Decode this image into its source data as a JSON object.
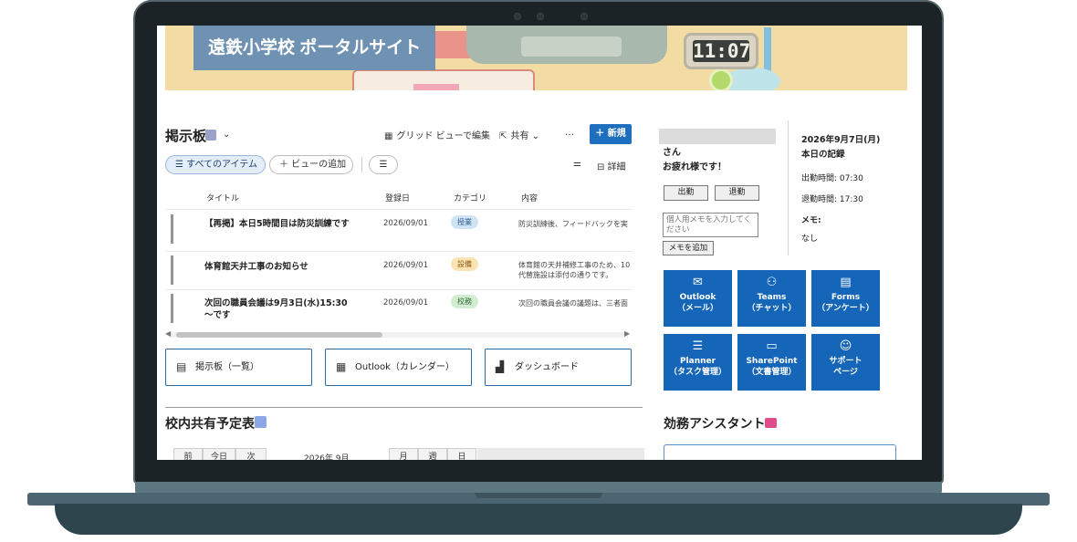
{
  "banner": {
    "title": "遠鉄小学校 ポータルサイト",
    "clock": "11:07"
  },
  "list": {
    "title": "掲示板",
    "commands": {
      "grid_edit": "グリッド ビューで編集",
      "share": "共有",
      "more": "…",
      "new": "新規"
    },
    "views": {
      "all_items": "すべてのアイテム",
      "add_view": "ビューの追加",
      "details": "詳細"
    },
    "columns": [
      "タイトル",
      "登録日",
      "カテゴリ",
      "内容"
    ],
    "rows": [
      {
        "title": "【再掲】本日5時間目は防災訓練です",
        "date": "2026/09/01",
        "category": "授業",
        "body": "防災訓練後、フィードバックを実"
      },
      {
        "title": "体育館天井工事のお知らせ",
        "date": "2026/09/01",
        "category": "設備",
        "body": "体育館の天井補修工事のため、10",
        "body2": "代替施設は添付の通りです。"
      },
      {
        "title": "次回の職員会議は9月3日(水)15:30～です",
        "date": "2026/09/01",
        "category": "校務",
        "body": "次回の職員会議の議題は、三者面"
      }
    ],
    "tag_colors": {
      "授業": "#cfe3f5",
      "設備": "#fbe3b4",
      "校務": "#d2ecd2"
    }
  },
  "links": [
    {
      "label": "掲示板（一覧）",
      "icon": "message-icon"
    },
    {
      "label": "Outlook（カレンダー）",
      "icon": "calendar-icon"
    },
    {
      "label": "ダッシュボード",
      "icon": "chart-icon"
    }
  ],
  "schedule": {
    "title": "校内共有予定表",
    "prev": "前",
    "today": "今日",
    "next": "次",
    "month": "2026年 9月",
    "month_view": "月",
    "week_view": "週",
    "day_view": "日"
  },
  "user": {
    "honorific": "さん",
    "greeting": "お疲れ様です！",
    "clock_in": "出勤",
    "clock_out": "退勤",
    "memo_placeholder": "個人用メモを入力してください",
    "memo_add": "メモを追加"
  },
  "record": {
    "date": "2026年9月7日(月)",
    "heading": "本日の記録",
    "clock_in_time": "出勤時間: 07:30",
    "clock_out_time": "退勤時間: 17:30",
    "memo_label": "メモ:",
    "memo_value": "なし"
  },
  "tiles": [
    {
      "name": "Outlook",
      "sub": "（メール）",
      "icon": "mail-icon",
      "glyph": "✉"
    },
    {
      "name": "Teams",
      "sub": "（チャット）",
      "icon": "teams-icon",
      "glyph": "⚇"
    },
    {
      "name": "Forms",
      "sub": "（アンケート）",
      "icon": "forms-icon",
      "glyph": "▤"
    },
    {
      "name": "Planner",
      "sub": "（タスク管理）",
      "icon": "checklist-icon",
      "glyph": "☰"
    },
    {
      "name": "SharePoint",
      "sub": "（文書管理）",
      "icon": "folder-icon",
      "glyph": "▭"
    },
    {
      "name": "サポート",
      "sub": "ページ",
      "icon": "smile-icon",
      "glyph": "☺"
    }
  ],
  "assistant": {
    "title": "効務アシスタント"
  },
  "colors": {
    "accent": "#1f6fbf",
    "tile": "#1565b8",
    "banner_title": "#6f91b2"
  }
}
